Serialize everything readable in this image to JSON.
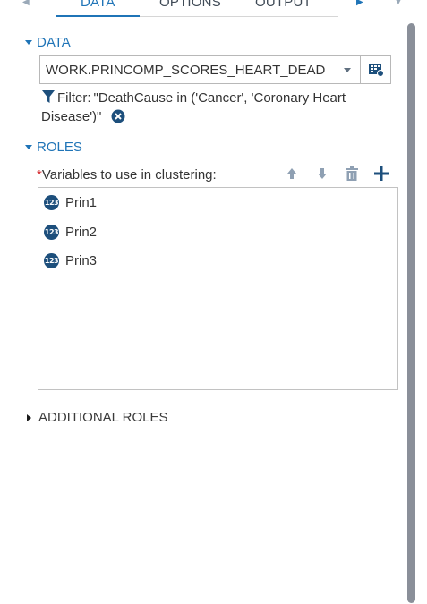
{
  "tabs": [
    {
      "label": "DATA",
      "active": true
    },
    {
      "label": "OPTIONS",
      "active": false
    },
    {
      "label": "OUTPUT",
      "active": false
    }
  ],
  "data_section": {
    "title": "DATA",
    "dataset": "WORK.PRINCOMP_SCORES_HEART_DEAD",
    "filter_label": "Filter:",
    "filter_expression": "\"DeathCause in ('Cancer', 'Coronary Heart Disease')\""
  },
  "roles_section": {
    "title": "ROLES",
    "required_marker": "*",
    "variables_label": "Variables to use in clustering:",
    "variables": [
      {
        "name": "Prin1",
        "type": "123"
      },
      {
        "name": "Prin2",
        "type": "123"
      },
      {
        "name": "Prin3",
        "type": "123"
      }
    ]
  },
  "additional_roles": {
    "title": "ADDITIONAL ROLES"
  },
  "icons": {
    "filter": "funnel-icon",
    "clear_filter": "close-circle-icon",
    "move_up": "arrow-up-icon",
    "move_down": "arrow-down-icon",
    "delete": "trash-icon",
    "add": "plus-icon",
    "table_picker": "table-icon"
  },
  "colors": {
    "accent": "#1f74b7",
    "badge": "#1d4f7c",
    "required": "#d4282d",
    "scrollbar": "#8a8f99"
  }
}
